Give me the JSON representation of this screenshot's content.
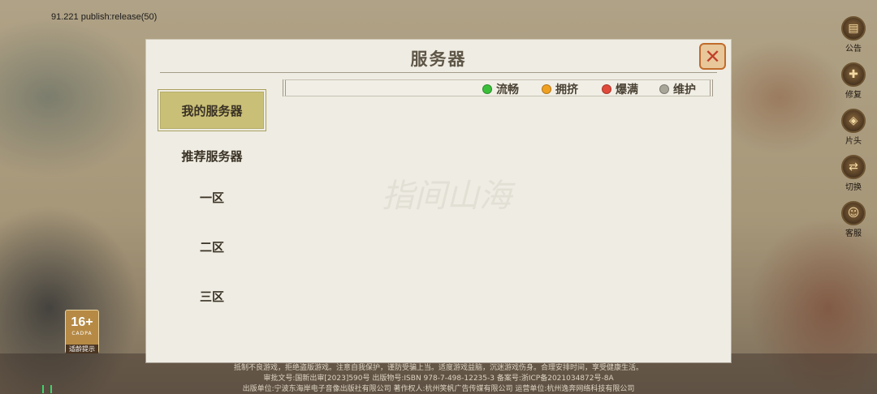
{
  "app": {
    "version_text": "91.221  publish:release(50)"
  },
  "dialog": {
    "title": "服务器",
    "watermark": "指间山海",
    "close_icon": "close-x-icon"
  },
  "tabs": [
    {
      "label": "我的服务器",
      "active": true
    },
    {
      "label": "推荐服务器",
      "active": false
    },
    {
      "label": "一区",
      "active": false
    },
    {
      "label": "二区",
      "active": false
    },
    {
      "label": "三区",
      "active": false
    }
  ],
  "status_legend": [
    {
      "label": "流畅",
      "color": "#3bbf3b"
    },
    {
      "label": "拥挤",
      "color": "#f0a020"
    },
    {
      "label": "爆满",
      "color": "#e04a3a"
    },
    {
      "label": "维护",
      "color": "#a8a698"
    }
  ],
  "side_menu": [
    {
      "label": "公告",
      "icon": "book-icon"
    },
    {
      "label": "修复",
      "icon": "wrench-icon"
    },
    {
      "label": "片头",
      "icon": "film-icon"
    },
    {
      "label": "切换",
      "icon": "switch-icon"
    },
    {
      "label": "客服",
      "icon": "support-icon"
    }
  ],
  "age_rating": {
    "number": "16+",
    "subtitle": "CADPA",
    "label": "适龄提示"
  },
  "footer": {
    "line1": "抵制不良游戏，拒绝盗版游戏。注意自我保护，谨防受骗上当。适度游戏益脑，沉迷游戏伤身。合理安排时间，享受健康生活。",
    "line2": "审批文号:国新出审[2023]590号  出版物号:ISBN 978-7-498-12235-3  备案号:浙ICP备2021034872号-8A",
    "line3": "出版单位:宁波东海岸电子音像出版社有限公司  著作权人:杭州笑帆广告传媒有限公司    运营单位:杭州逸奔网络科技有限公司"
  }
}
